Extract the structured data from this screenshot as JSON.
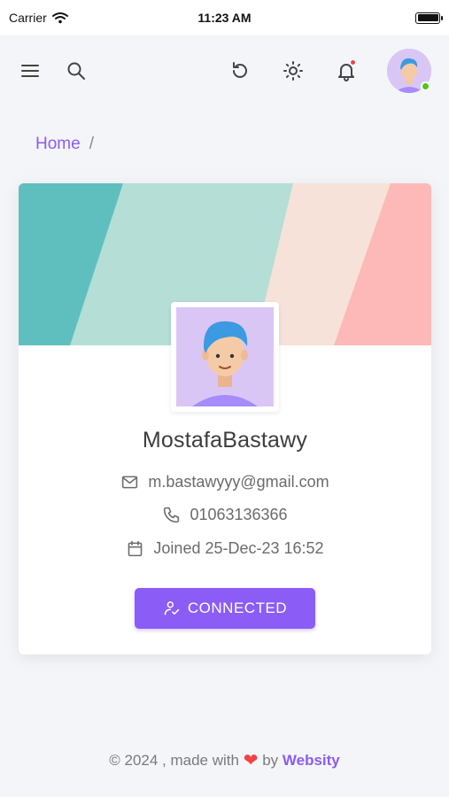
{
  "status_bar": {
    "carrier": "Carrier",
    "time": "11:23 AM"
  },
  "navbar": {
    "menu_icon": "hamburger-menu-icon",
    "search_icon": "search-icon",
    "refresh_icon": "refresh-icon",
    "theme_icon": "sun-icon",
    "notification_icon": "bell-icon",
    "avatar_status": "online"
  },
  "breadcrumb": {
    "home": "Home",
    "separator": "/"
  },
  "profile": {
    "name": "MostafaBastawy",
    "email": "m.bastawyyy@gmail.com",
    "phone": "01063136366",
    "joined": "Joined 25-Dec-23 16:52",
    "connect_label": "CONNECTED"
  },
  "banner_colors": [
    "#5fbfbf",
    "#b4ded6",
    "#f6e2d8",
    "#fdb8b8"
  ],
  "footer": {
    "copyright": "© 2024 , made with",
    "by": "by",
    "brand": "Websity"
  },
  "colors": {
    "accent": "#8b5cf6",
    "online": "#52c41a",
    "notification": "#ef4444"
  }
}
